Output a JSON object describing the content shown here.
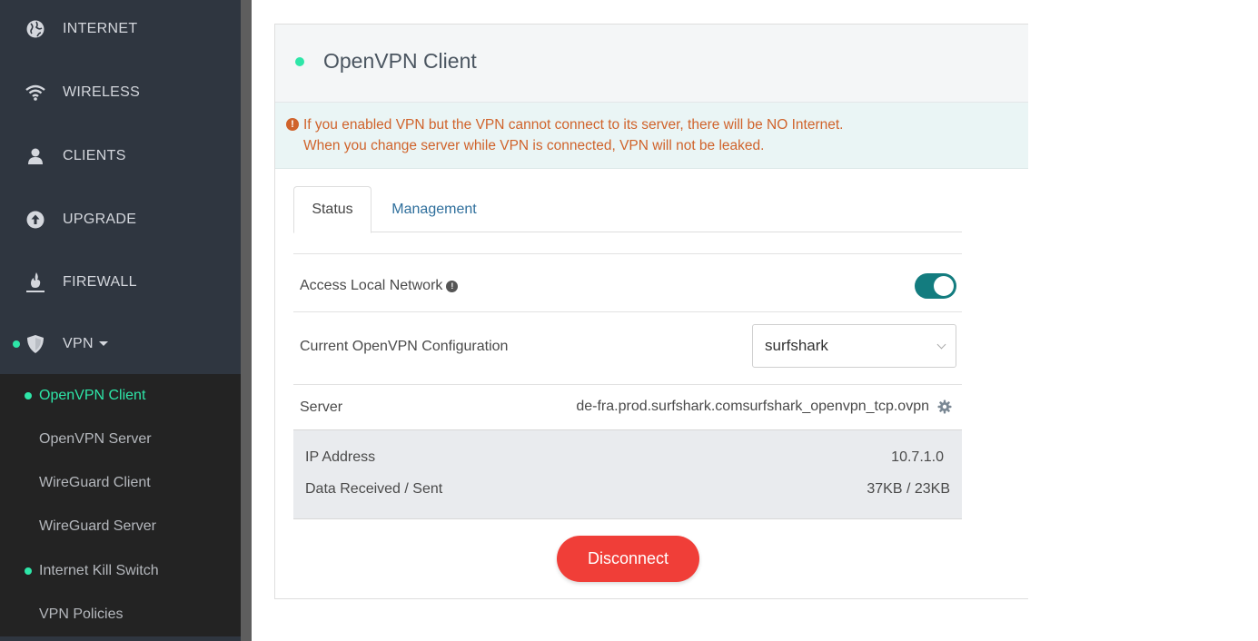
{
  "sidebar": {
    "items": [
      {
        "label": "INTERNET",
        "icon": "globe-icon"
      },
      {
        "label": "WIRELESS",
        "icon": "wifi-icon"
      },
      {
        "label": "CLIENTS",
        "icon": "user-icon"
      },
      {
        "label": "UPGRADE",
        "icon": "upgrade-icon"
      },
      {
        "label": "FIREWALL",
        "icon": "fire-icon"
      },
      {
        "label": "VPN",
        "icon": "shield-icon"
      }
    ],
    "vpn_submenu": [
      {
        "label": "OpenVPN Client",
        "active": true
      },
      {
        "label": "OpenVPN Server"
      },
      {
        "label": "WireGuard Client"
      },
      {
        "label": "WireGuard Server"
      },
      {
        "label": "Internet Kill Switch"
      },
      {
        "label": "VPN Policies"
      }
    ]
  },
  "card": {
    "title": "OpenVPN Client",
    "alert": {
      "line1": "If you enabled VPN but the VPN cannot connect to its server, there will be NO Internet.",
      "line2": "When you change server while VPN is connected, VPN will not be leaked."
    },
    "tabs": [
      "Status",
      "Management"
    ],
    "access_local_network": {
      "label": "Access Local Network",
      "enabled": true
    },
    "configuration": {
      "label": "Current OpenVPN Configuration",
      "value": "surfshark"
    },
    "server": {
      "label": "Server",
      "value": "de-fra.prod.surfshark.comsurfshark_openvpn_tcp.ovpn"
    },
    "stats": {
      "ip_label": "IP Address",
      "ip_value": "10.7.1.0",
      "data_label": "Data Received / Sent",
      "data_value": "37KB / 23KB"
    },
    "disconnect_label": "Disconnect"
  },
  "colors": {
    "accent_green": "#2ee6a8",
    "toggle_teal": "#137c7f",
    "disconnect_red": "#f03e38",
    "alert_orange": "#d0632b",
    "sidebar_bg": "#2f3640"
  }
}
